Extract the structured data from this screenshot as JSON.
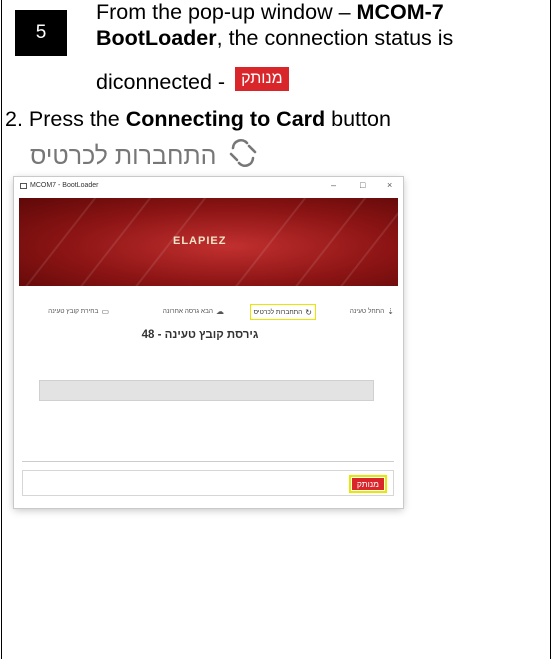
{
  "step": {
    "number": "5",
    "line1_prefix": "From the pop-up window – ",
    "line1_bold": "MCOM-7",
    "line2_bold": "BootLoader",
    "line2_suffix": ", the connection status is",
    "line3_text": "diconnected -",
    "status_label": "מנותק",
    "line4_prefix": "2. Press the ",
    "line4_bold": "Connecting to Card",
    "line4_suffix": " button",
    "connect_button_label": "התחברות לכרטיס"
  },
  "window": {
    "title": "MCOM7 - BootLoader",
    "controls": [
      "–",
      "□",
      "×"
    ],
    "banner_logo": "ELAPIEZ",
    "tabs": [
      {
        "label": "התחל טעינה",
        "icon": "download-icon"
      },
      {
        "label": "התחברות לכרטיס",
        "icon": "connect-icon"
      },
      {
        "label": "הבא גרסה אחרונה",
        "icon": "cloud-icon"
      },
      {
        "label": "בחירת קובץ טעינה",
        "icon": "folder-icon"
      }
    ],
    "version_text": "גירסת קובץ טעינה - 48",
    "status_label": "מנותק"
  }
}
